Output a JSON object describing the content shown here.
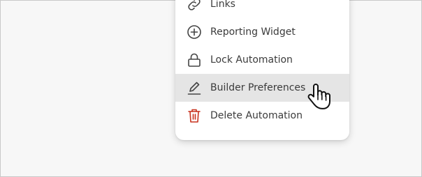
{
  "menu": {
    "items": [
      {
        "label": "Links",
        "icon": "link-icon"
      },
      {
        "label": "Reporting Widget",
        "icon": "plus-circle-icon"
      },
      {
        "label": "Lock Automation",
        "icon": "lock-icon"
      },
      {
        "label": "Builder Preferences",
        "icon": "pencil-icon",
        "state": "hover"
      },
      {
        "label": "Delete Automation",
        "icon": "trash-icon",
        "color": "#c8321e"
      }
    ]
  },
  "cursor": {
    "icon": "hand-pointer-cursor"
  }
}
